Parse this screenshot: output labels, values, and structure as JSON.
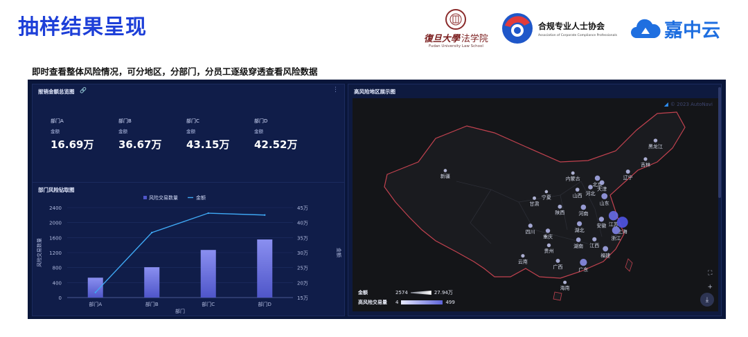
{
  "slide": {
    "title": "抽样结果呈现",
    "subtitle": "即时查看整体风险情况，可分地区，分部门，分员工逐级穿透查看风险数据"
  },
  "logos": {
    "fudan_name": "復旦大學",
    "fudan_dept": "法学院",
    "fudan_en": "Fudan University Law School",
    "ccp_cn": "合规专业人士协会",
    "ccp_en": "Association of Corporate Compliance Professionals",
    "jzy": "嘉中云"
  },
  "summary_panel": {
    "title": "报销金额总览图",
    "items": [
      {
        "dept": "部门A",
        "label": "金额",
        "value": "16.69万"
      },
      {
        "dept": "部门B",
        "label": "金额",
        "value": "36.67万"
      },
      {
        "dept": "部门C",
        "label": "金额",
        "value": "43.15万"
      },
      {
        "dept": "部门D",
        "label": "金额",
        "value": "42.52万"
      }
    ]
  },
  "chart_panel": {
    "title": "部门风险钻取图"
  },
  "chart_data": {
    "type": "bar",
    "categories": [
      "部门A",
      "部门B",
      "部门C",
      "部门D"
    ],
    "series": [
      {
        "name": "风险交易数量",
        "kind": "bar",
        "values": [
          530,
          810,
          1270,
          1550
        ]
      },
      {
        "name": "金额",
        "kind": "line",
        "values": [
          16.69,
          36.67,
          43.15,
          42.52
        ]
      }
    ],
    "xlabel": "部门",
    "ylabel": "风险交易数量",
    "ylabel_right": "金额",
    "ylim": [
      0,
      2400
    ],
    "y_ticks": [
      "0",
      "400",
      "800",
      "1200",
      "1600",
      "2000",
      "2400"
    ],
    "ylim_right": [
      15,
      45
    ],
    "y2_ticks": [
      "15万",
      "20万",
      "25万",
      "30万",
      "35万",
      "40万",
      "45万"
    ],
    "legend": "top-center",
    "colors": {
      "bar_top": "#8a8ff0",
      "bar_bottom": "#4f56c9",
      "line": "#3fa9f5"
    }
  },
  "map_panel": {
    "title": "高风险地区展示图",
    "watermark": "© 2023 AutoNavi",
    "legend": {
      "size_label": "金额",
      "size_min": "2574",
      "size_max": "27.94万",
      "color_label": "高风险交易量",
      "color_min": "4",
      "color_max": "499"
    },
    "provinces": [
      {
        "name": "黑龙江",
        "lon": 128.0,
        "lat": 47.5,
        "value": 60
      },
      {
        "name": "吉林",
        "lon": 126.0,
        "lat": 43.8,
        "value": 50
      },
      {
        "name": "辽宁",
        "lon": 122.5,
        "lat": 41.3,
        "value": 80
      },
      {
        "name": "内蒙古",
        "lon": 111.5,
        "lat": 41.0,
        "value": 40
      },
      {
        "name": "北京",
        "lon": 116.4,
        "lat": 40.0,
        "value": 150
      },
      {
        "name": "天津",
        "lon": 117.3,
        "lat": 39.1,
        "value": 120
      },
      {
        "name": "河北",
        "lon": 115.0,
        "lat": 38.2,
        "value": 110
      },
      {
        "name": "山西",
        "lon": 112.4,
        "lat": 37.7,
        "value": 70
      },
      {
        "name": "新疆",
        "lon": 86.0,
        "lat": 41.5,
        "value": 30
      },
      {
        "name": "宁夏",
        "lon": 106.2,
        "lat": 37.3,
        "value": 25
      },
      {
        "name": "甘肃",
        "lon": 103.8,
        "lat": 36.0,
        "value": 40
      },
      {
        "name": "陕西",
        "lon": 108.9,
        "lat": 34.3,
        "value": 80
      },
      {
        "name": "山东",
        "lon": 117.8,
        "lat": 36.4,
        "value": 200
      },
      {
        "name": "河南",
        "lon": 113.6,
        "lat": 34.2,
        "value": 150
      },
      {
        "name": "江苏",
        "lon": 119.6,
        "lat": 32.5,
        "value": 400
      },
      {
        "name": "安徽",
        "lon": 117.2,
        "lat": 31.8,
        "value": 140
      },
      {
        "name": "上海",
        "lon": 121.4,
        "lat": 31.2,
        "value": 499
      },
      {
        "name": "湖北",
        "lon": 112.8,
        "lat": 30.9,
        "value": 130
      },
      {
        "name": "四川",
        "lon": 103.0,
        "lat": 30.5,
        "value": 90
      },
      {
        "name": "重庆",
        "lon": 106.5,
        "lat": 29.5,
        "value": 100
      },
      {
        "name": "浙江",
        "lon": 120.1,
        "lat": 29.6,
        "value": 300
      },
      {
        "name": "湖南",
        "lon": 112.6,
        "lat": 27.7,
        "value": 110
      },
      {
        "name": "江西",
        "lon": 115.8,
        "lat": 27.8,
        "value": 90
      },
      {
        "name": "贵州",
        "lon": 106.7,
        "lat": 26.6,
        "value": 60
      },
      {
        "name": "福建",
        "lon": 118.0,
        "lat": 25.9,
        "value": 160
      },
      {
        "name": "云南",
        "lon": 101.5,
        "lat": 24.5,
        "value": 50
      },
      {
        "name": "广西",
        "lon": 108.5,
        "lat": 23.5,
        "value": 80
      },
      {
        "name": "广东",
        "lon": 113.6,
        "lat": 23.2,
        "value": 260
      },
      {
        "name": "海南",
        "lon": 109.9,
        "lat": 19.2,
        "value": 40
      }
    ]
  }
}
